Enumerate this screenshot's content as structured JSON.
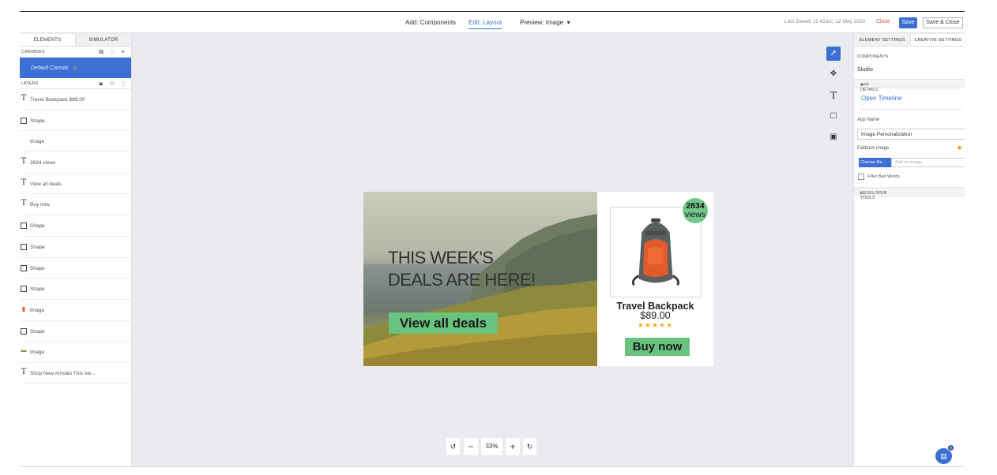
{
  "topbar": {
    "nav_add": "Add: Components",
    "nav_edit": "Edit: Layout",
    "nav_preview": "Preview: Image",
    "preview_caret": "▾",
    "last_saved": "Last Saved: 11:41am, 12 May 2023",
    "close_label": "Close",
    "save_label": "Save",
    "save_close_label": "Save & Close"
  },
  "left_panel": {
    "tabs": [
      "ELEMENTS",
      "SIMULATOR"
    ],
    "canvases_label": "CANVASES",
    "canvas_item": "Default Canvas",
    "warning_icon": "⚠",
    "layers_label": "LAYERS",
    "layers": [
      {
        "icon": "text",
        "label": "Travel Backpack $89.00"
      },
      {
        "icon": "shape",
        "label": "Shape"
      },
      {
        "icon": "image",
        "label": "Image"
      },
      {
        "icon": "text",
        "label": "2834 views"
      },
      {
        "icon": "text",
        "label": "View all deals"
      },
      {
        "icon": "text",
        "label": "Buy now"
      },
      {
        "icon": "shape",
        "label": "Shape"
      },
      {
        "icon": "shape",
        "label": "Shape"
      },
      {
        "icon": "shape",
        "label": "Shape"
      },
      {
        "icon": "shape",
        "label": "Shape"
      },
      {
        "icon": "image-backpack",
        "label": "Image"
      },
      {
        "icon": "shape",
        "label": "Shape"
      },
      {
        "icon": "image-landscape",
        "label": "Image"
      },
      {
        "icon": "text",
        "label": "Shop New Arrivals This we..."
      }
    ]
  },
  "ad": {
    "headline_line1": "THIS WEEK'S",
    "headline_line2": "DEALS ARE HERE!",
    "deals_button": "View all deals",
    "views_count": "2834",
    "views_label": "views",
    "product_name": "Travel Backpack",
    "product_price": "$89.00",
    "rating_stars": "★★★★★",
    "buy_button": "Buy now"
  },
  "zoom": {
    "level": "33%",
    "minus": "−",
    "plus": "+",
    "undo": "↺",
    "redo": "↻"
  },
  "right_panel": {
    "tabs": [
      "ELEMENT SETTINGS",
      "CREATIVE SETTINGS"
    ],
    "components_label": "COMPONENTS",
    "components_value": "Studio",
    "app_details_label": "APP DETAILS",
    "open_timeline": "Open Timeline",
    "app_name_label": "App Name",
    "app_name_value": "Image Personalization",
    "fallback_label": "Fallback image",
    "choose_file": "Choose file...",
    "add_image_placeholder": "Add an image",
    "filter_bad_words": "Filter Bad Words",
    "developer_tools_label": "DEVELOPER TOOLS"
  },
  "chat": {
    "badge": "6"
  },
  "colors": {
    "accent": "#3b6fd4",
    "cta_green": "#69c37e",
    "canvas_bg": "#e9ebee",
    "close_red": "#e0563a"
  }
}
